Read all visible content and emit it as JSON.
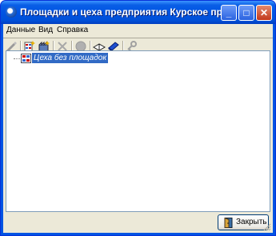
{
  "window": {
    "title": "Площадки и цеха предприятия Курское предприяти..."
  },
  "menu": {
    "items": [
      "Данные",
      "Вид",
      "Справка"
    ]
  },
  "toolbar": {
    "icons": [
      "edit-icon",
      "add-site-icon",
      "add-workshop-icon",
      "delete-icon",
      "stop-icon",
      "open-book-icon",
      "blue-book-icon",
      "key-icon"
    ]
  },
  "tree": {
    "nodes": [
      {
        "label": "Цеха без площадок",
        "selected": true
      }
    ]
  },
  "footer": {
    "close_label": "Закрыть"
  },
  "colors": {
    "title_bar": "#0054e3",
    "selection": "#316ac5",
    "face": "#ece9d8"
  }
}
